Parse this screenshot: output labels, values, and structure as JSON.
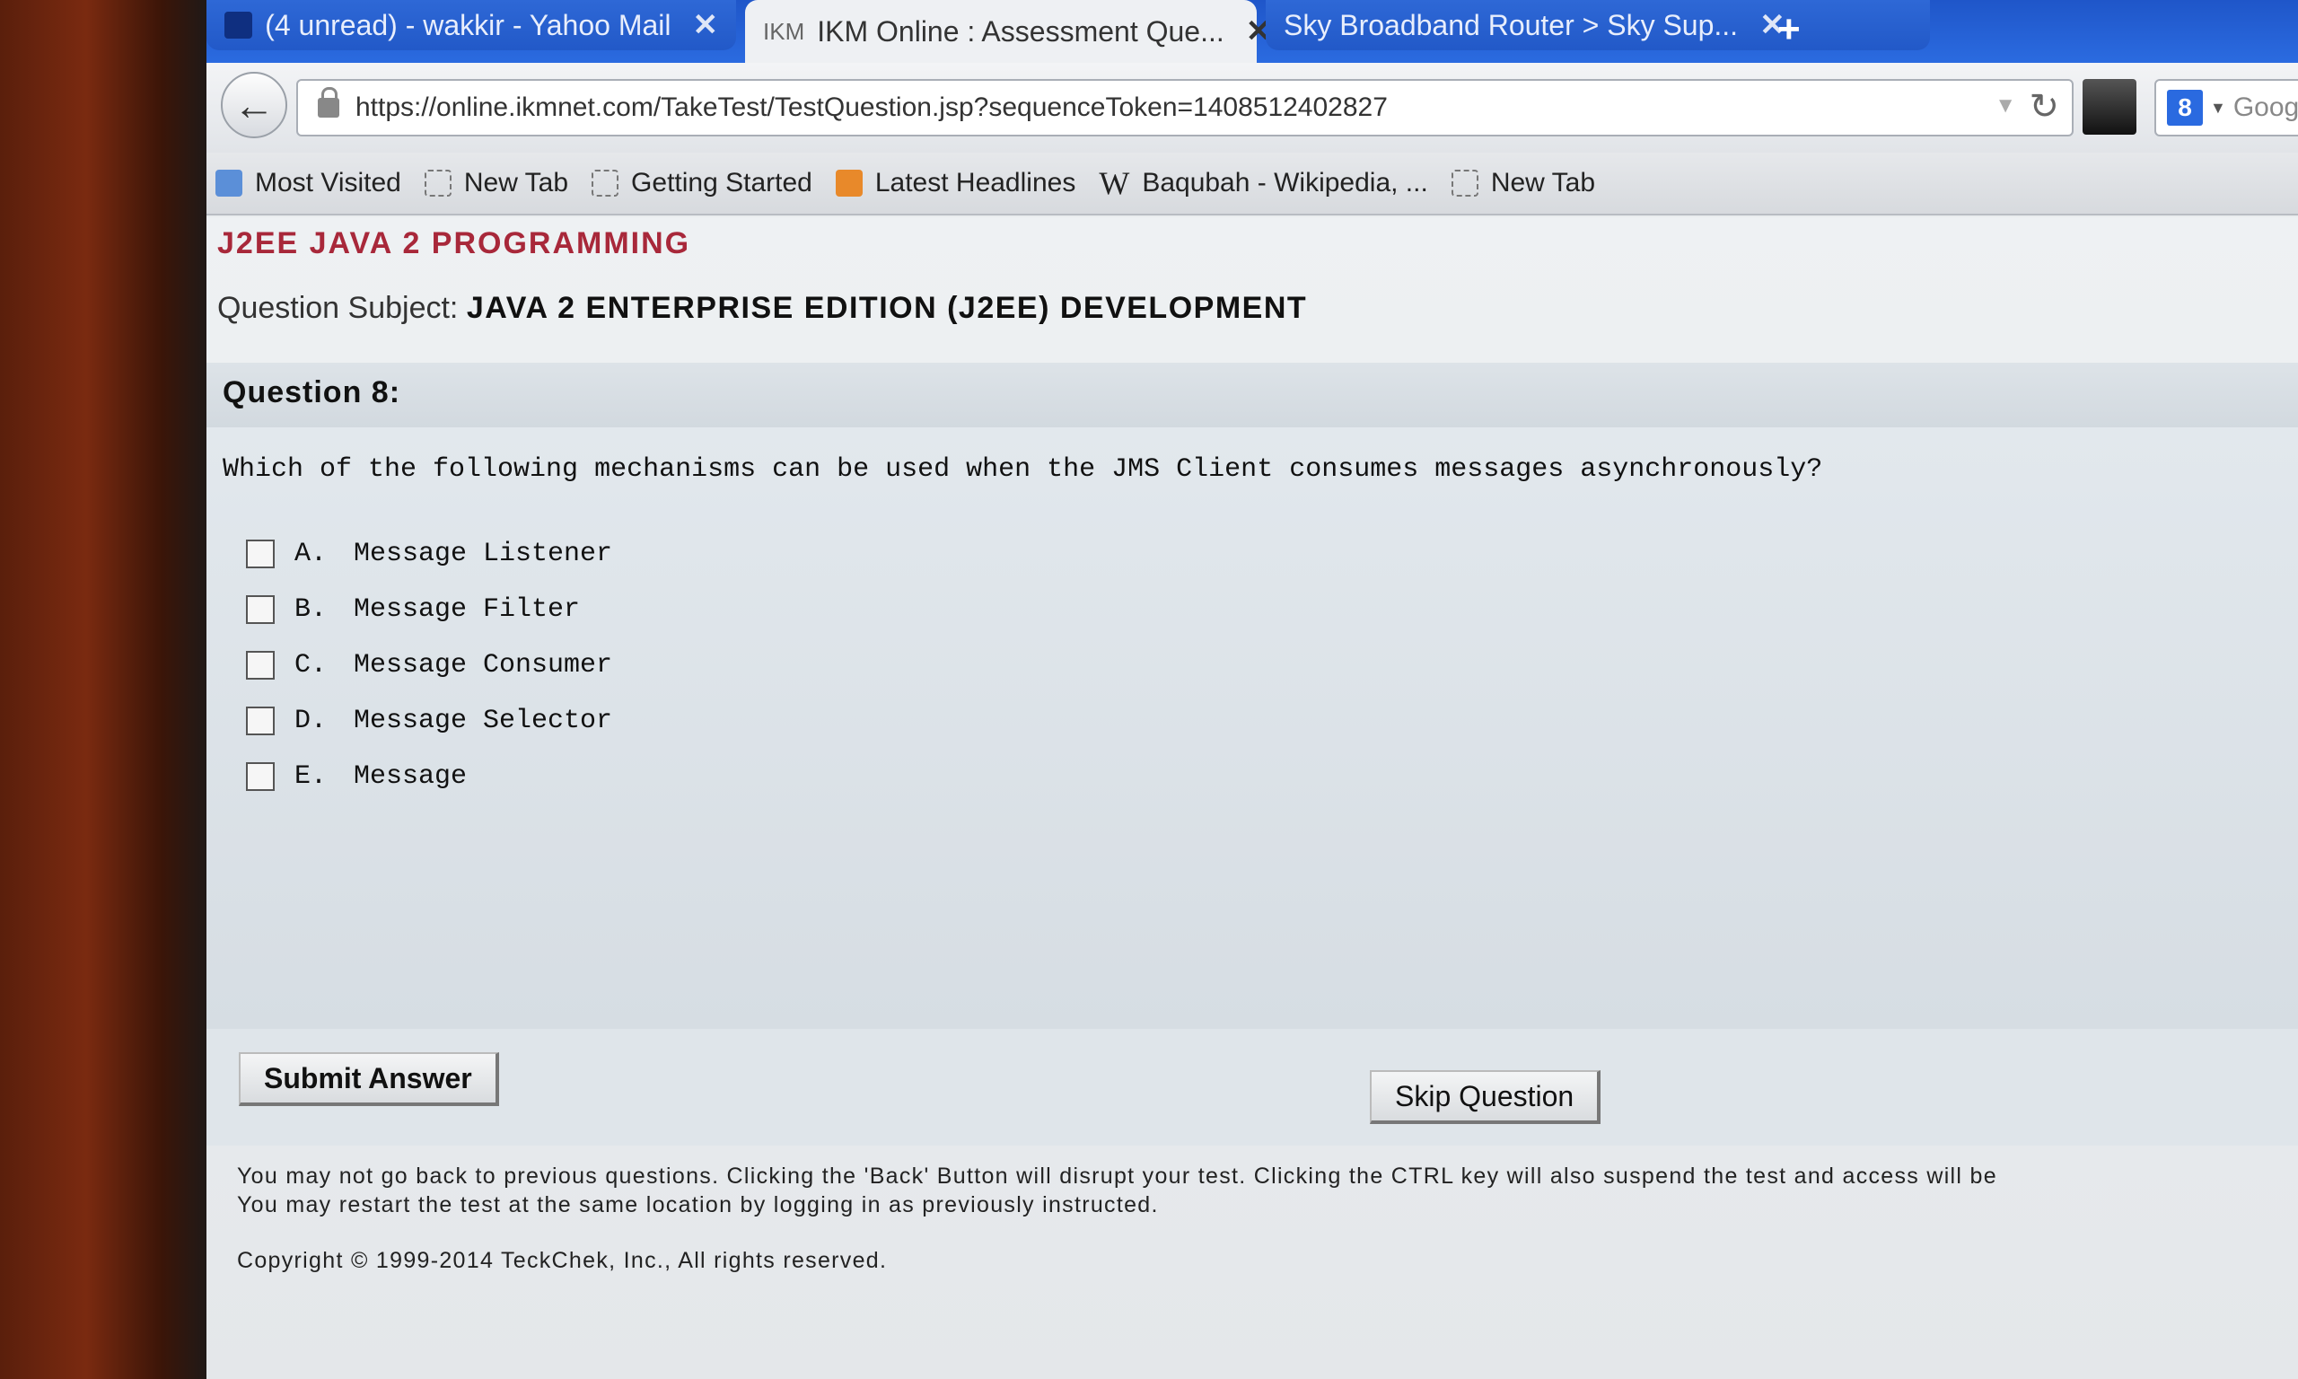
{
  "browser": {
    "tabs": [
      {
        "label": "(4 unread) - wakkir - Yahoo Mail"
      },
      {
        "label": "IKM Online : Assessment Que..."
      },
      {
        "label": "Sky Broadband Router > Sky Sup..."
      }
    ],
    "close_glyph": "✕",
    "new_tab_glyph": "+",
    "tab2_favicon_text": "IKM",
    "url": "https://online.ikmnet.com/TakeTest/TestQuestion.jsp?sequenceToken=1408512402827",
    "search_engine_letter": "8",
    "search_placeholder": "Goog",
    "bookmarks": [
      {
        "label": "Most Visited"
      },
      {
        "label": "New Tab"
      },
      {
        "label": "Getting Started"
      },
      {
        "label": "Latest Headlines"
      },
      {
        "label": "Baqubah - Wikipedia, ..."
      },
      {
        "label": "New Tab"
      }
    ],
    "wiki_icon_text": "W"
  },
  "page": {
    "course_title": "J2EE JAVA 2 PROGRAMMING",
    "subject_label": "Question Subject:",
    "subject_value": "JAVA 2 ENTERPRISE EDITION (J2EE) DEVELOPMENT",
    "question_number": "Question 8:",
    "question_text": "Which of the following mechanisms can be used when the JMS Client consumes messages asynchronously?",
    "options": [
      {
        "letter": "A.",
        "text": "Message Listener"
      },
      {
        "letter": "B.",
        "text": "Message Filter"
      },
      {
        "letter": "C.",
        "text": "Message Consumer"
      },
      {
        "letter": "D.",
        "text": "Message Selector"
      },
      {
        "letter": "E.",
        "text": "Message"
      }
    ],
    "submit_label": "Submit Answer",
    "skip_label": "Skip Question",
    "notice_line1": "You may not go back to previous questions. Clicking the 'Back' Button will disrupt your test. Clicking the CTRL key will also suspend the test and access will be",
    "notice_line2": "You may restart the test at the same location by logging in as previously instructed.",
    "copyright": "Copyright © 1999-2014 TeckChek, Inc., All rights reserved."
  }
}
